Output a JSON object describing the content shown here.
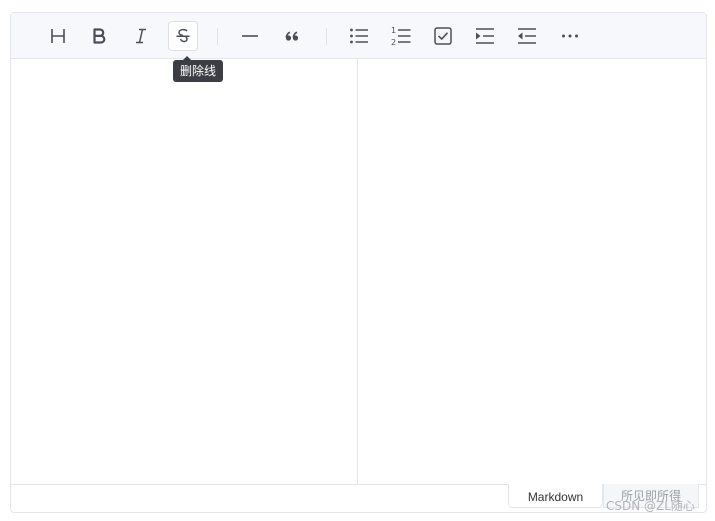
{
  "toolbar": {
    "tools": [
      {
        "name": "heading",
        "icon": "heading-icon"
      },
      {
        "name": "bold",
        "icon": "bold-icon"
      },
      {
        "name": "italic",
        "icon": "italic-icon"
      },
      {
        "name": "strike",
        "icon": "strikethrough-icon",
        "active": true
      },
      {
        "name": "hr",
        "icon": "horizontal-rule-icon"
      },
      {
        "name": "quote",
        "icon": "quote-icon"
      },
      {
        "name": "bullet-list",
        "icon": "bullet-list-icon"
      },
      {
        "name": "ordered-list",
        "icon": "ordered-list-icon"
      },
      {
        "name": "task",
        "icon": "task-checkbox-icon"
      },
      {
        "name": "indent",
        "icon": "indent-icon"
      },
      {
        "name": "outdent",
        "icon": "outdent-icon"
      },
      {
        "name": "more",
        "icon": "more-icon"
      }
    ],
    "tooltip": "删除线"
  },
  "footer": {
    "markdown_tab": "Markdown",
    "wysiwyg_tab": "所见即所得"
  },
  "watermark": "CSDN @ZL随心",
  "colors": {
    "toolbar_bg": "#f7f8fc",
    "border": "#e3e6ee",
    "icon": "#4a4f57",
    "tooltip_bg": "#3b3f45"
  }
}
